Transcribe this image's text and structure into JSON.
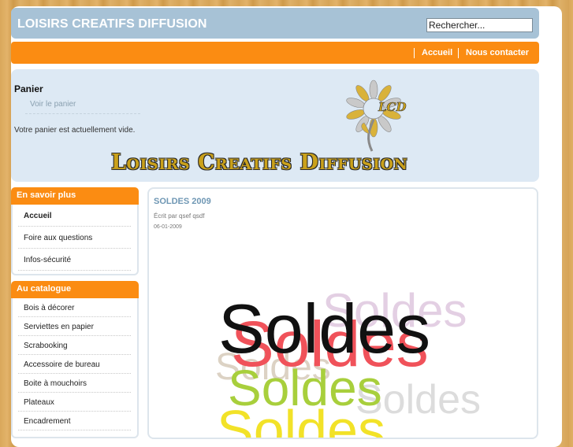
{
  "header": {
    "site_title": "LOISIRS CREATIFS DIFFUSION",
    "search_value": "Rechercher..."
  },
  "nav": {
    "home": "Accueil",
    "contact": "Nous contacter"
  },
  "cart": {
    "title": "Panier",
    "view_link": "Voir le panier",
    "empty_message": "Votre panier est actuellement vide."
  },
  "banner": {
    "logo_initials": "LCD",
    "logo_text": "Loisirs Creatifs Diffusion"
  },
  "sidebar": {
    "info": {
      "title": "En savoir plus",
      "items": [
        "Accueil",
        "Foire aux questions",
        "Infos-sécurité"
      ]
    },
    "catalog": {
      "title": "Au catalogue",
      "items": [
        "Bois à décorer",
        "Serviettes en papier",
        "Scrabooking",
        "Accessoire de bureau",
        "Boite à mouchoirs",
        "Plateaux",
        "Encadrement"
      ]
    }
  },
  "article": {
    "title": "SOLDES 2009",
    "author": "Écrit par qsef qsdf",
    "date": "06-01-2009",
    "image_text": "Soldes"
  },
  "colors": {
    "accent_orange": "#fb8c12",
    "header_blue": "#a7c2d6",
    "banner_bg": "#dde9f4",
    "title_blue": "#6f97b4"
  }
}
